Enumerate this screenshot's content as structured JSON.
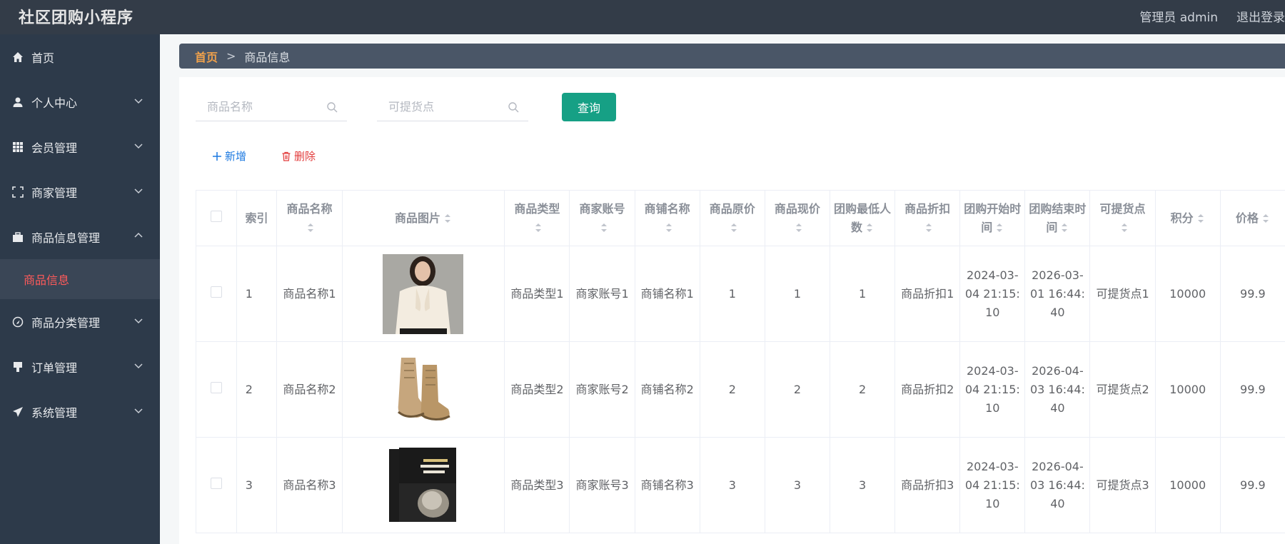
{
  "header": {
    "app_title": "社区团购小程序",
    "admin_label": "管理员 admin",
    "logout_label": "退出登录"
  },
  "sidebar": {
    "items": [
      {
        "label": "首页",
        "icon": "home-icon"
      },
      {
        "label": "个人中心",
        "icon": "user-icon"
      },
      {
        "label": "会员管理",
        "icon": "grid-icon"
      },
      {
        "label": "商家管理",
        "icon": "frame-icon"
      },
      {
        "label": "商品信息管理",
        "icon": "briefcase-icon"
      },
      {
        "label": "商品分类管理",
        "icon": "compass-icon"
      },
      {
        "label": "订单管理",
        "icon": "stamp-icon"
      },
      {
        "label": "系统管理",
        "icon": "send-icon"
      }
    ],
    "active_sub": "商品信息"
  },
  "breadcrumb": {
    "home": "首页",
    "separator": ">",
    "current": "商品信息"
  },
  "search": {
    "name_placeholder": "商品名称",
    "pickup_placeholder": "可提货点",
    "query_label": "查询"
  },
  "actions": {
    "add_label": "新增",
    "delete_label": "删除"
  },
  "table": {
    "headers": [
      "索引",
      "商品名称",
      "商品图片",
      "商品类型",
      "商家账号",
      "商铺名称",
      "商品原价",
      "商品现价",
      "团购最低人数",
      "商品折扣",
      "团购开始时间",
      "团购结束时间",
      "可提货点",
      "积分",
      "价格"
    ],
    "rows": [
      {
        "index": "1",
        "name": "商品名称1",
        "image": "blouse-photo",
        "type": "商品类型1",
        "account": "商家账号1",
        "shop": "商铺名称1",
        "orig_price": "1",
        "cur_price": "1",
        "min_people": "1",
        "discount": "商品折扣1",
        "start": "2024-03-04 21:15:10",
        "end": "2026-03-01 16:44:40",
        "pickup": "可提货点1",
        "points": "10000",
        "price": "99.9"
      },
      {
        "index": "2",
        "name": "商品名称2",
        "image": "boots-photo",
        "type": "商品类型2",
        "account": "商家账号2",
        "shop": "商铺名称2",
        "orig_price": "2",
        "cur_price": "2",
        "min_people": "2",
        "discount": "商品折扣2",
        "start": "2024-03-04 21:15:10",
        "end": "2026-04-03 16:44:40",
        "pickup": "可提货点2",
        "points": "10000",
        "price": "99.9"
      },
      {
        "index": "3",
        "name": "商品名称3",
        "image": "book-photo",
        "type": "商品类型3",
        "account": "商家账号3",
        "shop": "商铺名称3",
        "orig_price": "3",
        "cur_price": "3",
        "min_people": "3",
        "discount": "商品折扣3",
        "start": "2024-03-04 21:15:10",
        "end": "2026-04-03 16:44:40",
        "pickup": "可提货点3",
        "points": "10000",
        "price": "99.9"
      }
    ]
  },
  "colors": {
    "topbar": "#333c48",
    "sidebar": "#2d3a4a",
    "accent_green": "#16a085",
    "active_red": "#ff5a5a",
    "crumb_home": "#f0a14b"
  }
}
